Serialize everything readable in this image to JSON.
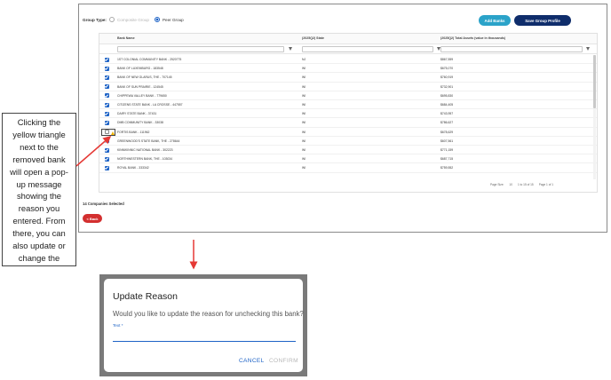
{
  "group_type": {
    "label": "Group Type:",
    "option_composite": "Composite Group",
    "option_peer": "Peer Group",
    "selected": "Peer Group"
  },
  "toolbar": {
    "add_banks": "Add Banks",
    "save_group_profile": "Save Group Profile"
  },
  "grid": {
    "columns": [
      "Bank Name",
      "(2025Q2) State",
      "(2025Q2) Total Assets (value in thousands)"
    ],
    "rows": [
      {
        "name": "1ST COLONIAL COMMUNITY BANK - 2520775",
        "state": "NJ",
        "assets": "$867,559",
        "checked": true
      },
      {
        "name": "BANK OF LUXEMBURG - 183548",
        "state": "WI",
        "assets": "$675,070",
        "checked": true
      },
      {
        "name": "BANK OF NEW GLARUS, THE - 707145",
        "state": "WI",
        "assets": "$760,919",
        "checked": true
      },
      {
        "name": "BANK OF SUN PRAIRIE - 124545",
        "state": "WI",
        "assets": "$732,901",
        "checked": true
      },
      {
        "name": "CHIPPEWA VALLEY BANK - 779650",
        "state": "WI",
        "assets": "$695,830",
        "checked": true
      },
      {
        "name": "CITIZENS STATE BANK - LA CROSSE - 447557",
        "state": "WI",
        "assets": "$684,405",
        "checked": true
      },
      {
        "name": "DAIRY STATE BANK - 37431",
        "state": "WI",
        "assets": "$743,957",
        "checked": true
      },
      {
        "name": "DMB COMMUNITY BANK - 33038",
        "state": "WI",
        "assets": "$786,627",
        "checked": true
      },
      {
        "name": "FORTIS BANK - 111962",
        "state": "WI",
        "assets": "$678,629",
        "checked": false
      },
      {
        "name": "GREENWOOD'S STATE BANK, THE - 278644",
        "state": "WI",
        "assets": "$607,561",
        "checked": true
      },
      {
        "name": "KINNIKINNIC NATIONAL BANK - 302223",
        "state": "WI",
        "assets": "$771,159",
        "checked": true
      },
      {
        "name": "NORTHWESTERN BANK, THE - 103034",
        "state": "WI",
        "assets": "$687,715",
        "checked": true
      },
      {
        "name": "ROYAL BANK - 333342",
        "state": "WI",
        "assets": "$759,552",
        "checked": true
      }
    ],
    "pager": {
      "page_size_label": "Page Size:",
      "page_size": "10",
      "range": "1 to 15 of 15",
      "page": "Page 1 of 1"
    }
  },
  "selected_count": "14 Companies Selected",
  "back_label": "< Back",
  "callout_text": "Clicking the yellow triangle next to the removed bank will open a pop-up message showing the reason you entered. From there, you can also update or change the reason if needed",
  "dialog": {
    "title": "Update Reason",
    "message": "Would you like to update the reason for unchecking this bank?",
    "field_label": "Text *",
    "field_value": "",
    "cancel": "CANCEL",
    "confirm": "CONFIRM"
  },
  "colors": {
    "accent": "#1e63c6",
    "add_banks": "#2ba3c9",
    "save_profile": "#0f2d6b",
    "back": "#d32f2f",
    "warning": "#f2b400",
    "arrow": "#e53935"
  }
}
